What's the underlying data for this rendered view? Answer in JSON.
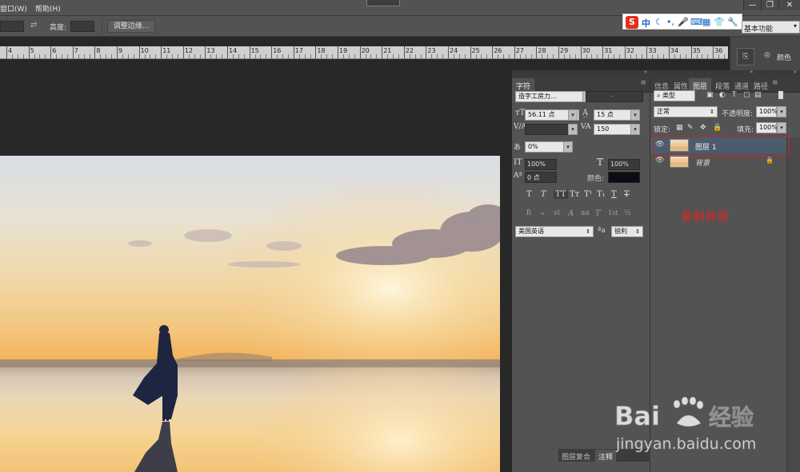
{
  "menubar": {
    "items": [
      "窗口(W)",
      "帮助(H)"
    ],
    "window_buttons": [
      "—",
      "❐",
      "✕"
    ]
  },
  "options_bar": {
    "height_label": "高度:",
    "refine_edge_button": "调整边缘..."
  },
  "ime": {
    "logo": "S",
    "mode": "中"
  },
  "workspace": {
    "selected": "基本功能"
  },
  "ruler": {
    "labels": [
      "4",
      "5",
      "6",
      "7",
      "8",
      "9",
      "10",
      "11",
      "12",
      "13",
      "14",
      "15",
      "16",
      "17",
      "18",
      "19",
      "20",
      "21",
      "22",
      "23",
      "24",
      "25",
      "26",
      "27",
      "28",
      "29",
      "30",
      "31",
      "32",
      "33",
      "34",
      "35",
      "36"
    ]
  },
  "dock": {
    "color_label": "颜色"
  },
  "character_panel": {
    "tab_title": "字符",
    "font_family": "造字工房力...",
    "font_style": "-",
    "font_size": "56.11 点",
    "leading": "15 点",
    "kerning": "",
    "tracking": "150",
    "tsume": "0%",
    "vertical_scale": "100%",
    "horizontal_scale": "100%",
    "baseline_shift": "0 点",
    "color_label": "颜色:",
    "style_buttons": [
      "T",
      "T",
      "TT",
      "Tт",
      "T¹",
      "T₁",
      "T",
      "T"
    ],
    "opentype_buttons": [
      "fi",
      "ℴ",
      "st",
      "A",
      "aa",
      "T",
      "1st",
      "½"
    ],
    "language": "美国英语",
    "aa_label": "ªa",
    "antialias": "锐利",
    "bottom_tabs": [
      "图层复合",
      "注释"
    ]
  },
  "layers_panel": {
    "tabs": [
      "信息",
      "属性",
      "图层",
      "段落",
      "通道",
      "路径"
    ],
    "active_tab": "图层",
    "filter_kind": "类型",
    "blend_mode": "正常",
    "opacity_label": "不透明度:",
    "opacity": "100%",
    "lock_label": "锁定:",
    "fill_label": "填充:",
    "fill": "100%",
    "layers": [
      {
        "name": "图层 1",
        "selected": true
      },
      {
        "name": "背景",
        "selected": false,
        "locked": true
      }
    ]
  },
  "annotation": "复制背景",
  "watermark": {
    "brand": "Bai",
    "brand_cn": "经验",
    "url": "jingyan.baidu.com"
  }
}
